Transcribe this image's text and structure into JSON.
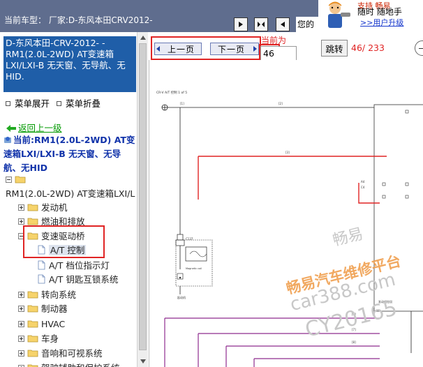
{
  "topbar": {
    "vehicle_label": "当前车型：  厂家:D-东风本田CRV2012-",
    "your_text": "您的"
  },
  "ad": {
    "line1": "支持  畅易",
    "line2": "随时 随地手",
    "line3": ">>用户升级"
  },
  "left": {
    "header_text": "D-东风本田-CRV-2012-  - RM1(2.0L-2WD) AT变速箱LXI/LXI-B 无天窗、无导航、无HID.",
    "expand_label": "菜单展开",
    "collapse_label": "菜单折叠",
    "back_label": "返回上一级",
    "current_text": "当前:RM1(2.0L-2WD) AT变速箱LXI/LXI-B 无天窗、无导航、无HID",
    "root_label": "RM1(2.0L-2WD) AT变速箱LXI/L",
    "tree": [
      {
        "label": "发动机",
        "expanded": false
      },
      {
        "label": "燃油和排放",
        "expanded": false
      },
      {
        "label": "变速驱动桥",
        "expanded": true
      },
      {
        "label": "A/T 控制",
        "selected": true
      },
      {
        "label": "A/T 档位指示灯"
      },
      {
        "label": "A/T 钥匙互锁系统"
      },
      {
        "label": "转向系统",
        "expanded": false
      },
      {
        "label": "制动器",
        "expanded": false
      },
      {
        "label": "HVAC",
        "expanded": false
      },
      {
        "label": "车身",
        "expanded": false
      },
      {
        "label": "音响和可视系统",
        "expanded": false
      },
      {
        "label": "驾驶辅助和保护系统",
        "expanded": false
      }
    ]
  },
  "toolbar": {
    "prev_label": "上一页",
    "next_label": "下一页",
    "current_page_label": "当前为",
    "page_value": "46",
    "jump_label": "跳转",
    "page_total": "46/ 233"
  },
  "diagram": {
    "header_text": "CR-V A/T 控制 1 of 5",
    "watermark_line1": "畅易",
    "watermark_line2": "畅易汽车维修平台",
    "watermark_line3": "car388.com",
    "watermark_line4": "CY20165",
    "wire_colors": {
      "red": "#e02424",
      "purple": "#8e2b8e",
      "black": "#222222"
    }
  },
  "colors": {
    "topbar_bg": "#5f6d8e",
    "header_box_bg": "#1f5ea8",
    "highlight_red": "#e02424",
    "link_green": "#009900",
    "current_blue": "#1133aa",
    "watermark_orange": "#f0a050",
    "watermark_gray": "#c8c8c8"
  }
}
